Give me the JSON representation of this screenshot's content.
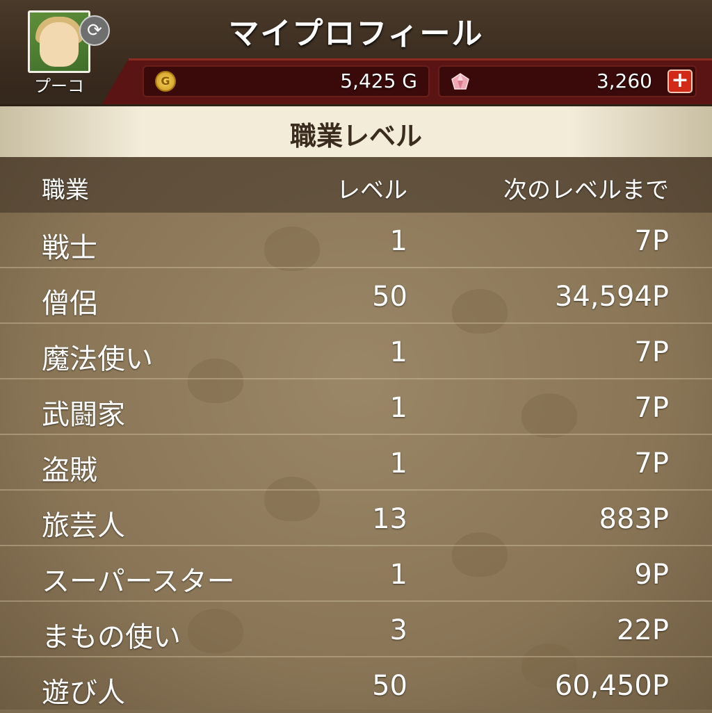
{
  "header": {
    "title": "マイプロフィール",
    "username": "プーコ",
    "gold": "5,425 G",
    "gems": "3,260",
    "plus_label": "+"
  },
  "section": {
    "title": "職業レベル"
  },
  "table": {
    "columns": [
      "職業",
      "レベル",
      "次のレベルまで"
    ],
    "rows": [
      {
        "job": "戦士",
        "level": "1",
        "next": "7P"
      },
      {
        "job": "僧侶",
        "level": "50",
        "next": "34,594P"
      },
      {
        "job": "魔法使い",
        "level": "1",
        "next": "7P"
      },
      {
        "job": "武闘家",
        "level": "1",
        "next": "7P"
      },
      {
        "job": "盗賊",
        "level": "1",
        "next": "7P"
      },
      {
        "job": "旅芸人",
        "level": "13",
        "next": "883P"
      },
      {
        "job": "スーパースター",
        "level": "1",
        "next": "9P"
      },
      {
        "job": "まもの使い",
        "level": "3",
        "next": "22P"
      },
      {
        "job": "遊び人",
        "level": "50",
        "next": "60,450P"
      }
    ]
  },
  "icons": {
    "coin": "gold-coin-icon",
    "gem": "gem-icon",
    "refresh": "refresh-icon",
    "plus": "plus-icon"
  },
  "colors": {
    "header_bg": "#3a2c1f",
    "wallet_band": "#5b1414",
    "plus_button": "#d12a18",
    "title_band": "#f3ecd9",
    "table_bg": "#8a7657"
  }
}
